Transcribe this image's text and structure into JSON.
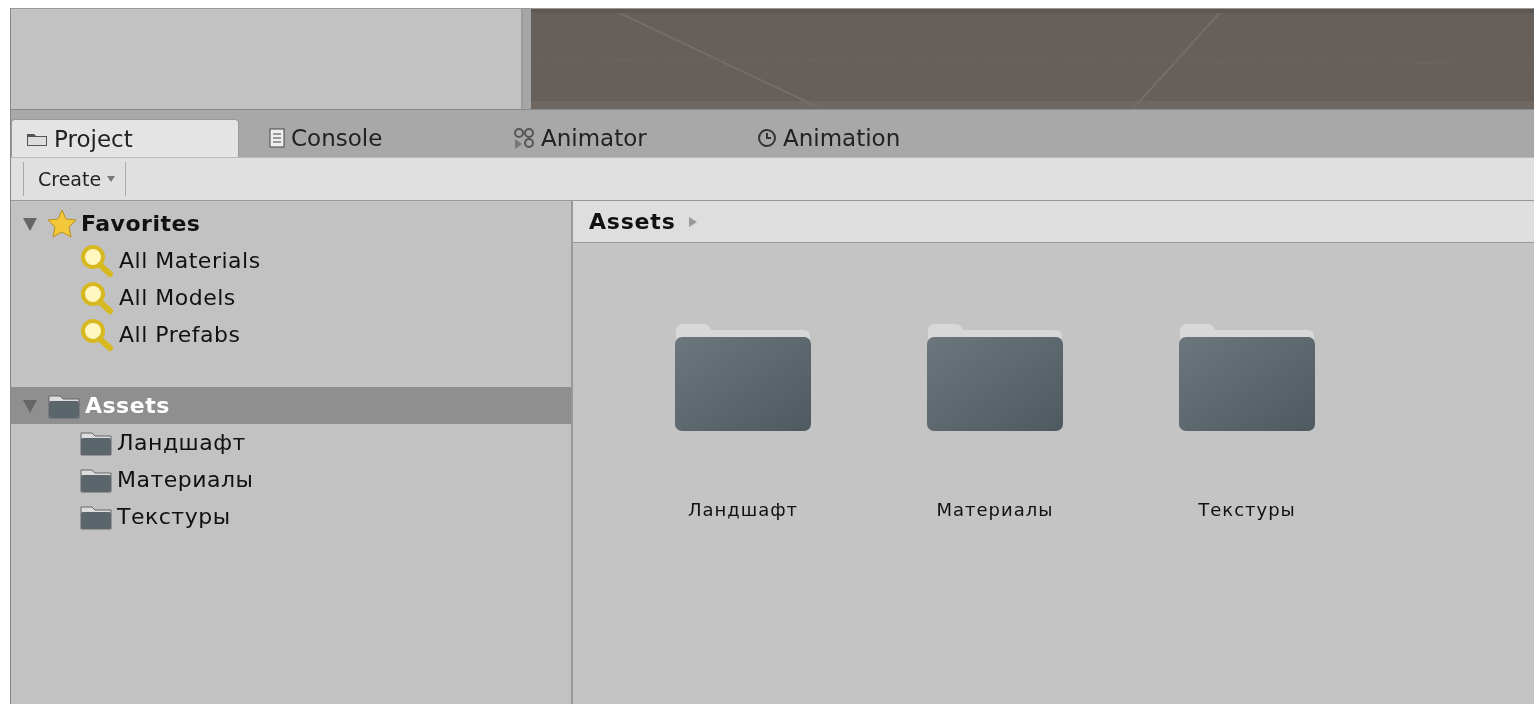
{
  "scene_view": {
    "kind": "picture"
  },
  "tabs": [
    {
      "label": "Project",
      "kind": "project",
      "selected": true
    },
    {
      "label": "Console",
      "kind": "console",
      "selected": false
    },
    {
      "label": "Animator",
      "kind": "animator",
      "selected": false
    },
    {
      "label": "Animation",
      "kind": "animation",
      "selected": false
    }
  ],
  "toolbar": {
    "create_button": "Create"
  },
  "tree": [
    {
      "label": "Favorites",
      "kind": "favorites",
      "expanded": true,
      "selected": false,
      "children": [
        {
          "label": "All Materials",
          "kind": "search",
          "selected": false
        },
        {
          "label": "All Models",
          "kind": "search",
          "selected": false
        },
        {
          "label": "All Prefabs",
          "kind": "search",
          "selected": false
        }
      ]
    },
    {
      "label": "Assets",
      "kind": "folder",
      "expanded": true,
      "selected": true,
      "children": [
        {
          "label": "Ландшафт",
          "kind": "folder",
          "selected": false
        },
        {
          "label": "Материалы",
          "kind": "folder",
          "selected": false
        },
        {
          "label": "Текстуры",
          "kind": "folder",
          "selected": false
        }
      ]
    }
  ],
  "breadcrumb": [
    "Assets"
  ],
  "grid_items": [
    {
      "label": "Ландшафт",
      "selected": false
    },
    {
      "label": "Материалы",
      "selected": false
    },
    {
      "label": "Текстуры",
      "selected": false
    }
  ]
}
